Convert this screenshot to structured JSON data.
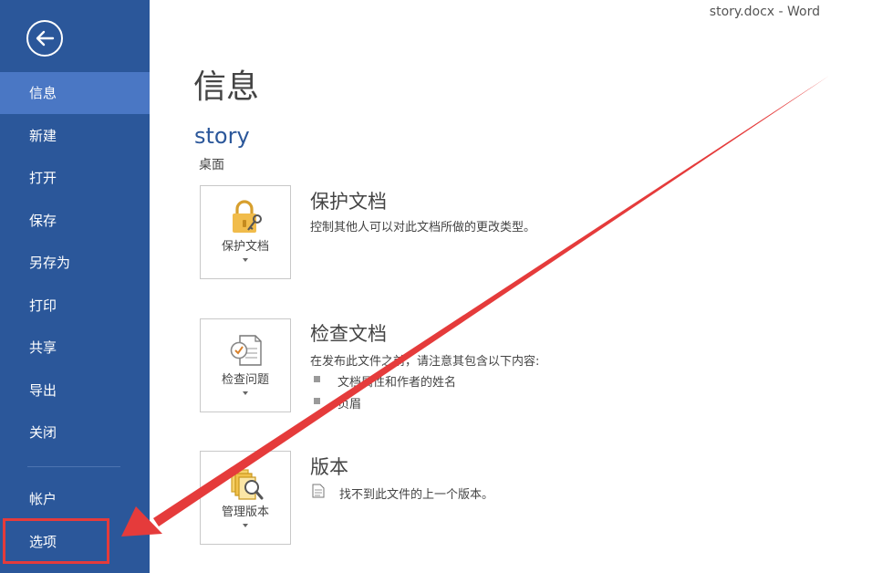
{
  "window": {
    "title": "story.docx - Word"
  },
  "sidebar": {
    "items": [
      {
        "label": "信息"
      },
      {
        "label": "新建"
      },
      {
        "label": "打开"
      },
      {
        "label": "保存"
      },
      {
        "label": "另存为"
      },
      {
        "label": "打印"
      },
      {
        "label": "共享"
      },
      {
        "label": "导出"
      },
      {
        "label": "关闭"
      },
      {
        "label": "帐户"
      },
      {
        "label": "选项"
      }
    ],
    "active_index": 0,
    "colors": {
      "background": "#2b579a",
      "active": "#4a77c4"
    }
  },
  "main": {
    "title": "信息",
    "document": {
      "name": "story",
      "location": "桌面"
    },
    "sections": [
      {
        "button_label": "保护文档",
        "heading": "保护文档",
        "description": "控制其他人可以对此文档所做的更改类型。",
        "icon": "lock-key-icon"
      },
      {
        "button_label": "检查问题",
        "heading": "检查文档",
        "description": "在发布此文件之前，请注意其包含以下内容:",
        "bullets": [
          "文档属性和作者的姓名",
          "页眉"
        ],
        "icon": "inspect-document-icon"
      },
      {
        "button_label": "管理版本",
        "heading": "版本",
        "description": "找不到此文件的上一个版本。",
        "icon": "manage-versions-icon"
      }
    ]
  },
  "annotation": {
    "color": "#e53b3b"
  }
}
